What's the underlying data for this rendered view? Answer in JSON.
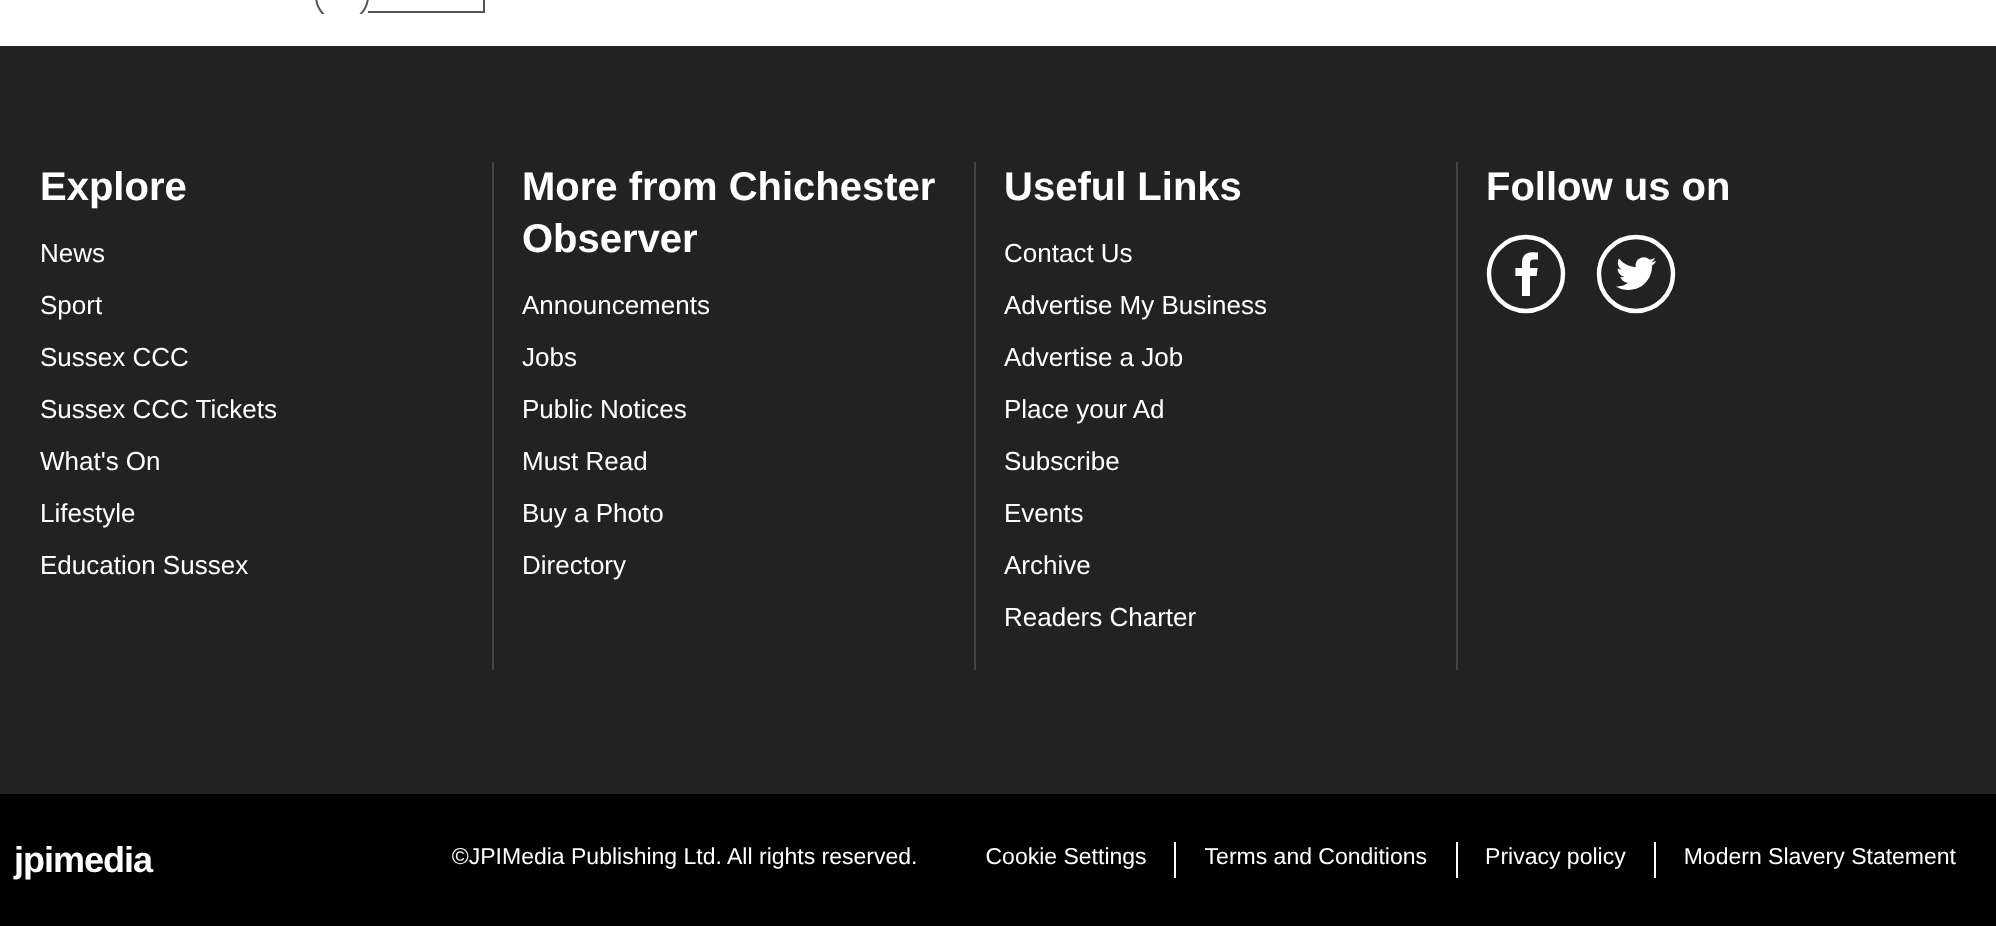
{
  "columns": [
    {
      "heading": "Explore",
      "links": [
        "News",
        "Sport",
        "Sussex CCC",
        "Sussex CCC Tickets",
        "What's On",
        "Lifestyle",
        "Education Sussex"
      ]
    },
    {
      "heading": "More from Chichester Observer",
      "links": [
        "Announcements",
        "Jobs",
        "Public Notices",
        "Must Read",
        "Buy a Photo",
        "Directory"
      ]
    },
    {
      "heading": "Useful Links",
      "links": [
        "Contact Us",
        "Advertise My Business",
        "Advertise a Job",
        "Place your Ad",
        "Subscribe",
        "Events",
        "Archive",
        "Readers Charter"
      ]
    },
    {
      "heading": "Follow us on",
      "social": [
        {
          "kind": "facebook"
        },
        {
          "kind": "twitter"
        }
      ]
    }
  ],
  "bottom_bar": {
    "logo": "jpimedia",
    "copyright": "©JPIMedia Publishing Ltd. All rights reserved.",
    "links": [
      "Cookie Settings",
      "Terms and Conditions",
      "Privacy policy",
      "Modern Slavery Statement"
    ]
  }
}
